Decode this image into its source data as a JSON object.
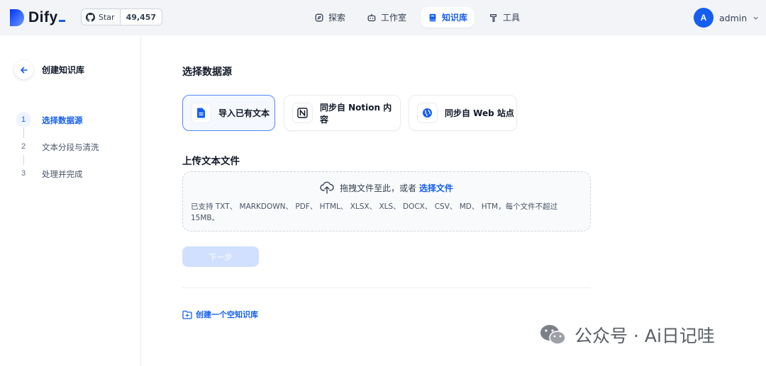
{
  "brand": {
    "name": "Dify",
    "accent": "#155eef"
  },
  "github": {
    "star_label": "Star",
    "count": "49,457",
    "icon": "github-icon"
  },
  "nav": [
    {
      "label": "探索",
      "icon": "compass-icon",
      "active": false
    },
    {
      "label": "工作室",
      "icon": "robot-icon",
      "active": false
    },
    {
      "label": "知识库",
      "icon": "book-icon",
      "active": true
    },
    {
      "label": "工具",
      "icon": "hammer-icon",
      "active": false
    }
  ],
  "user": {
    "initial": "A",
    "name": "admin"
  },
  "sidebar": {
    "title": "创建知识库",
    "steps": [
      {
        "num": "1",
        "label": "选择数据源",
        "active": true
      },
      {
        "num": "2",
        "label": "文本分段与清洗",
        "active": false
      },
      {
        "num": "3",
        "label": "处理并完成",
        "active": false
      }
    ]
  },
  "main": {
    "data_source_title": "选择数据源",
    "sources": [
      {
        "label": "导入已有文本",
        "icon": "file-icon",
        "active": true
      },
      {
        "label": "同步自 Notion 内容",
        "icon": "notion-icon",
        "active": false
      },
      {
        "label": "同步自 Web 站点",
        "icon": "globe-icon",
        "active": false
      }
    ],
    "upload_title": "上传文本文件",
    "dropzone": {
      "text": "拖拽文件至此，或者",
      "link": "选择文件",
      "tip": "已支持 TXT、 MARKDOWN、 PDF、 HTML、 XLSX、 XLS、 DOCX、 CSV、 MD、 HTM，每个文件不超过 15MB。"
    },
    "next_button": "下一步",
    "create_empty": "创建一个空知识库"
  },
  "watermark": "公众号 · Ai日记哇"
}
